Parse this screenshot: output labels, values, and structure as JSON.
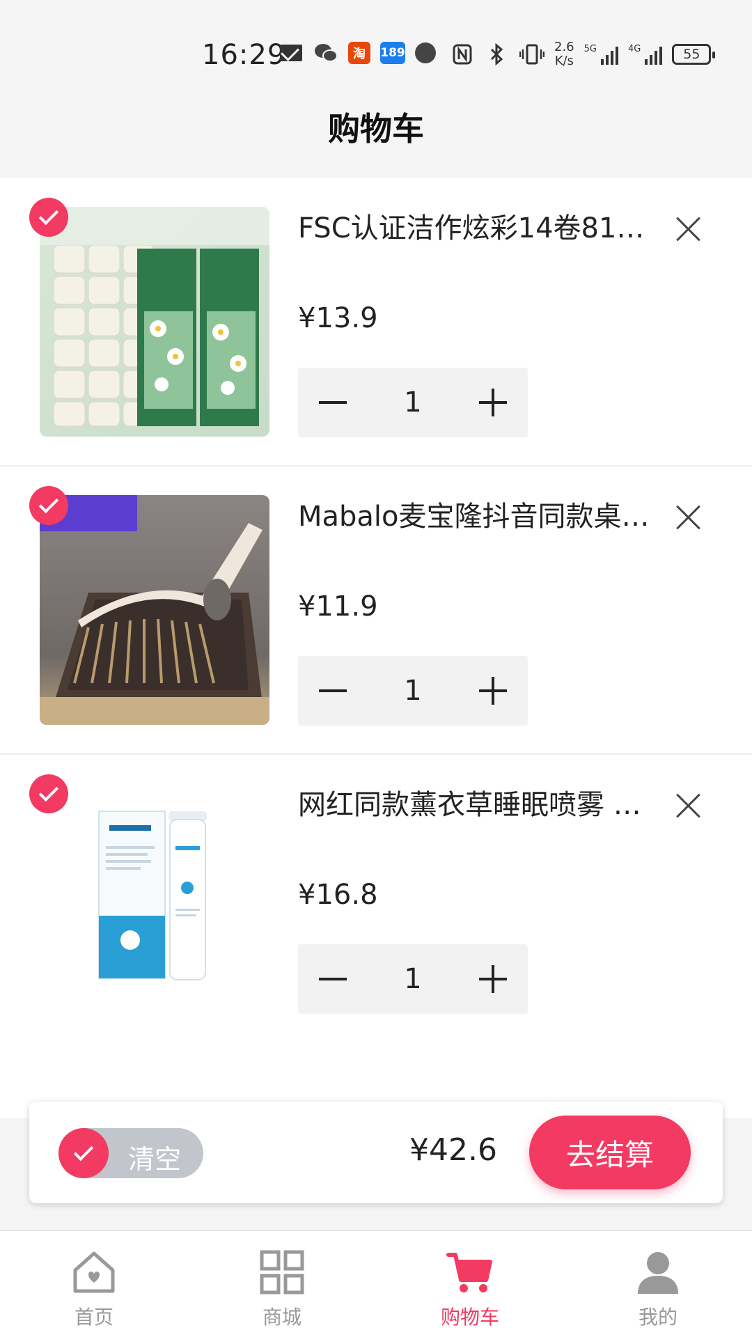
{
  "status_bar": {
    "time": "16:29",
    "net_speed_value": "2.6",
    "net_speed_unit": "K/s",
    "sim1_type": "5G",
    "sim2_type": "4G",
    "battery": "55",
    "taobao_label": "淘",
    "app189_label": "189"
  },
  "header": {
    "title": "购物车"
  },
  "cart": {
    "items": [
      {
        "title": "FSC认证洁作炫彩14卷81…",
        "price": "¥13.9",
        "quantity": "1",
        "selected": true
      },
      {
        "title": "Mabalo麦宝隆抖音同款桌…",
        "price": "¥11.9",
        "quantity": "1",
        "selected": true
      },
      {
        "title": "网红同款薰衣草睡眠喷雾 …",
        "price": "¥16.8",
        "quantity": "1",
        "selected": true
      }
    ]
  },
  "checkout": {
    "clear_label": "清空",
    "total": "¥42.6",
    "checkout_label": "去结算"
  },
  "nav": {
    "items": [
      {
        "label": "首页",
        "icon": "home-icon",
        "active": false
      },
      {
        "label": "商城",
        "icon": "grid-icon",
        "active": false
      },
      {
        "label": "购物车",
        "icon": "cart-icon",
        "active": true
      },
      {
        "label": "我的",
        "icon": "user-icon",
        "active": false
      }
    ]
  },
  "colors": {
    "accent": "#f23a63",
    "inactive": "#999999"
  }
}
